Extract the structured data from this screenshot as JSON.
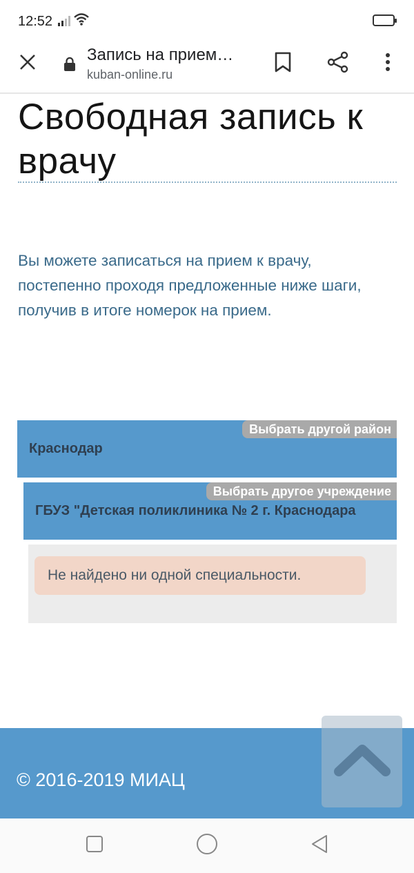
{
  "status_bar": {
    "time": "12:52",
    "icons": [
      "signal-icon",
      "wifi-icon",
      "battery-icon"
    ]
  },
  "browser": {
    "page_title": "Запись на прием…",
    "url": "kuban-online.ru",
    "icons": [
      "close-icon",
      "lock-icon",
      "bookmark-icon",
      "share-icon",
      "more-vert-icon"
    ]
  },
  "page": {
    "heading": "Свободная запись к врачу",
    "intro": "Вы можете записаться на прием к врачу, постепенно проходя предложенные ниже шаги, получив в итоге номерок на прием.",
    "region": {
      "change_label": "Выбрать другой район",
      "value": "Краснодар"
    },
    "facility": {
      "change_label": "Выбрать другое учреждение",
      "value": "ГБУЗ \"Детская поликлиника № 2 г. Краснодара"
    },
    "alert": "Не найдено ни одной специальности."
  },
  "footer": {
    "copyright": "© 2016-2019 МИАЦ",
    "scroll_top_icon": "chevron-up-icon"
  },
  "nav_bar": {
    "icons": [
      "recent-apps-icon",
      "home-icon",
      "back-icon"
    ]
  },
  "colors": {
    "accent_blue": "#5699cc",
    "tag_grey": "#a9a9a9",
    "alert_bg": "#f2d6c8",
    "intro_text": "#3a6a8a"
  }
}
